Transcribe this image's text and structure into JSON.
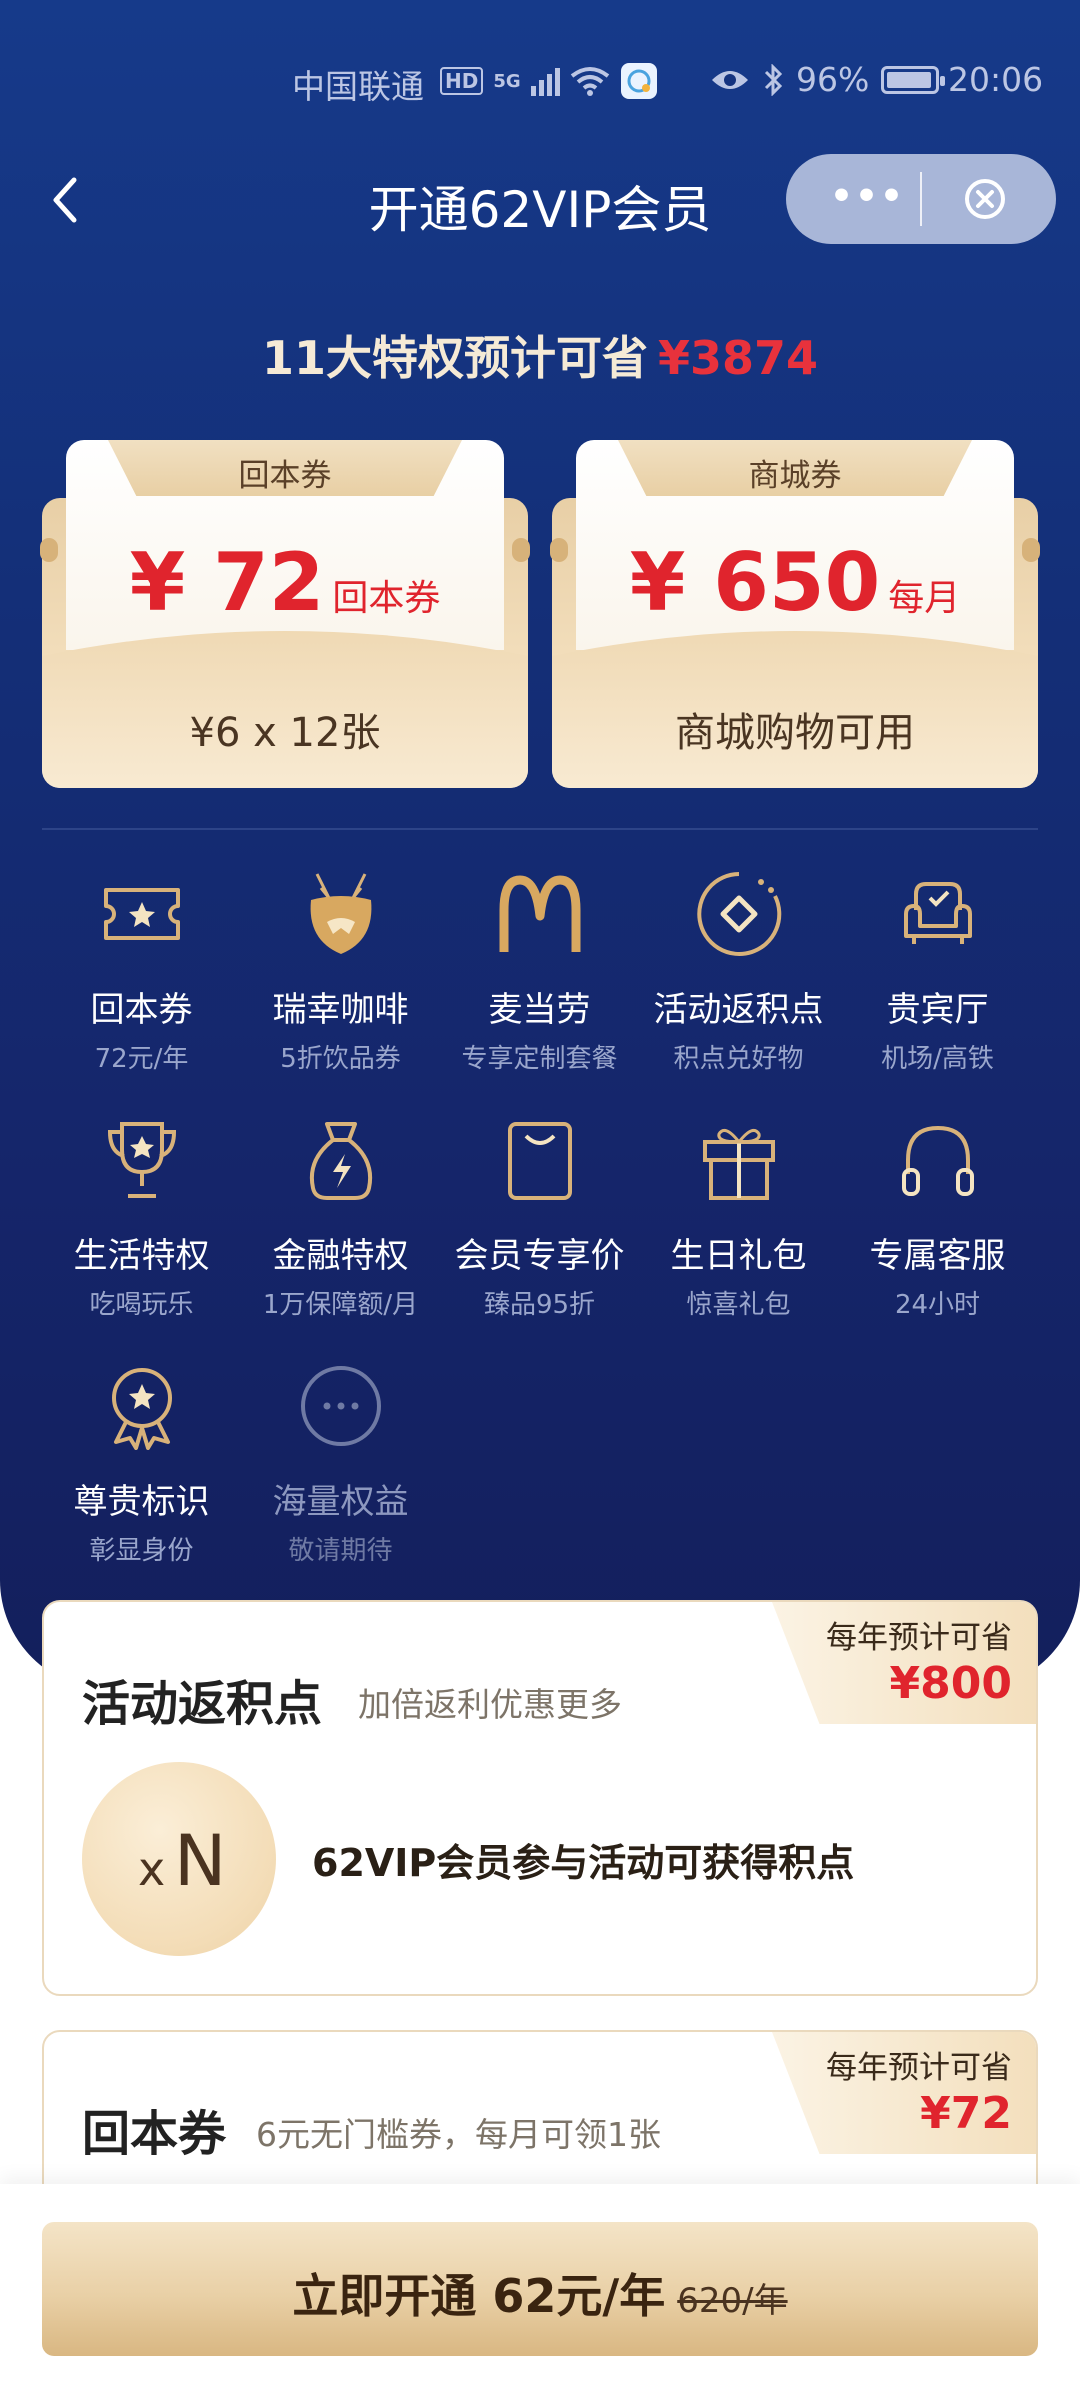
{
  "status": {
    "carrier": "中国联通",
    "hd": "HD",
    "network": "5G",
    "battery": "96%",
    "time": "20:06"
  },
  "nav": {
    "title": "开通62VIP会员",
    "more": "•••"
  },
  "savings": {
    "label": "11大特权预计可省",
    "amount": "¥3874"
  },
  "coupons": [
    {
      "tab": "回本券",
      "price": "¥ 72",
      "unit": "回本券",
      "foot": "¥6 x 12张"
    },
    {
      "tab": "商城券",
      "price": "¥ 650",
      "unit": "每月",
      "foot": "商城购物可用"
    }
  ],
  "privileges": [
    {
      "name": "回本券",
      "sub": "72元/年",
      "icon": "ticket-star-icon"
    },
    {
      "name": "瑞幸咖啡",
      "sub": "5折饮品券",
      "icon": "luckin-deer-icon"
    },
    {
      "name": "麦当劳",
      "sub": "专享定制套餐",
      "icon": "mcdonalds-icon"
    },
    {
      "name": "活动返积点",
      "sub": "积点兑好物",
      "icon": "diamond-coin-icon"
    },
    {
      "name": "贵宾厅",
      "sub": "机场/高铁",
      "icon": "lounge-sofa-icon"
    },
    {
      "name": "生活特权",
      "sub": "吃喝玩乐",
      "icon": "trophy-icon"
    },
    {
      "name": "金融特权",
      "sub": "1万保障额/月",
      "icon": "money-bag-icon"
    },
    {
      "name": "会员专享价",
      "sub": "臻品95折",
      "icon": "shopping-bag-icon"
    },
    {
      "name": "生日礼包",
      "sub": "惊喜礼包",
      "icon": "gift-icon"
    },
    {
      "name": "专属客服",
      "sub": "24小时",
      "icon": "headset-icon"
    },
    {
      "name": "尊贵标识",
      "sub": "彰显身份",
      "icon": "medal-icon"
    },
    {
      "name": "海量权益",
      "sub": "敬请期待",
      "icon": "more-circle-icon"
    }
  ],
  "card1": {
    "title": "活动返积点",
    "subtitle": "加倍返利优惠更多",
    "badge_label": "每年预计可省",
    "badge_amount": "¥800",
    "circle_x": "x",
    "circle_n": "N",
    "desc": "62VIP会员参与活动可获得积点"
  },
  "card2": {
    "title": "回本券",
    "subtitle": "6元无门槛券，每月可领1张",
    "badge_label": "每年预计可省",
    "badge_amount": "¥72"
  },
  "cta": {
    "label": "立即开通 62元/年",
    "original": "620/年"
  },
  "colors": {
    "hero_top": "#163a8a",
    "hero_bottom": "#131f5c",
    "accent_red": "#e0242d",
    "gold": "#d8b27a"
  }
}
